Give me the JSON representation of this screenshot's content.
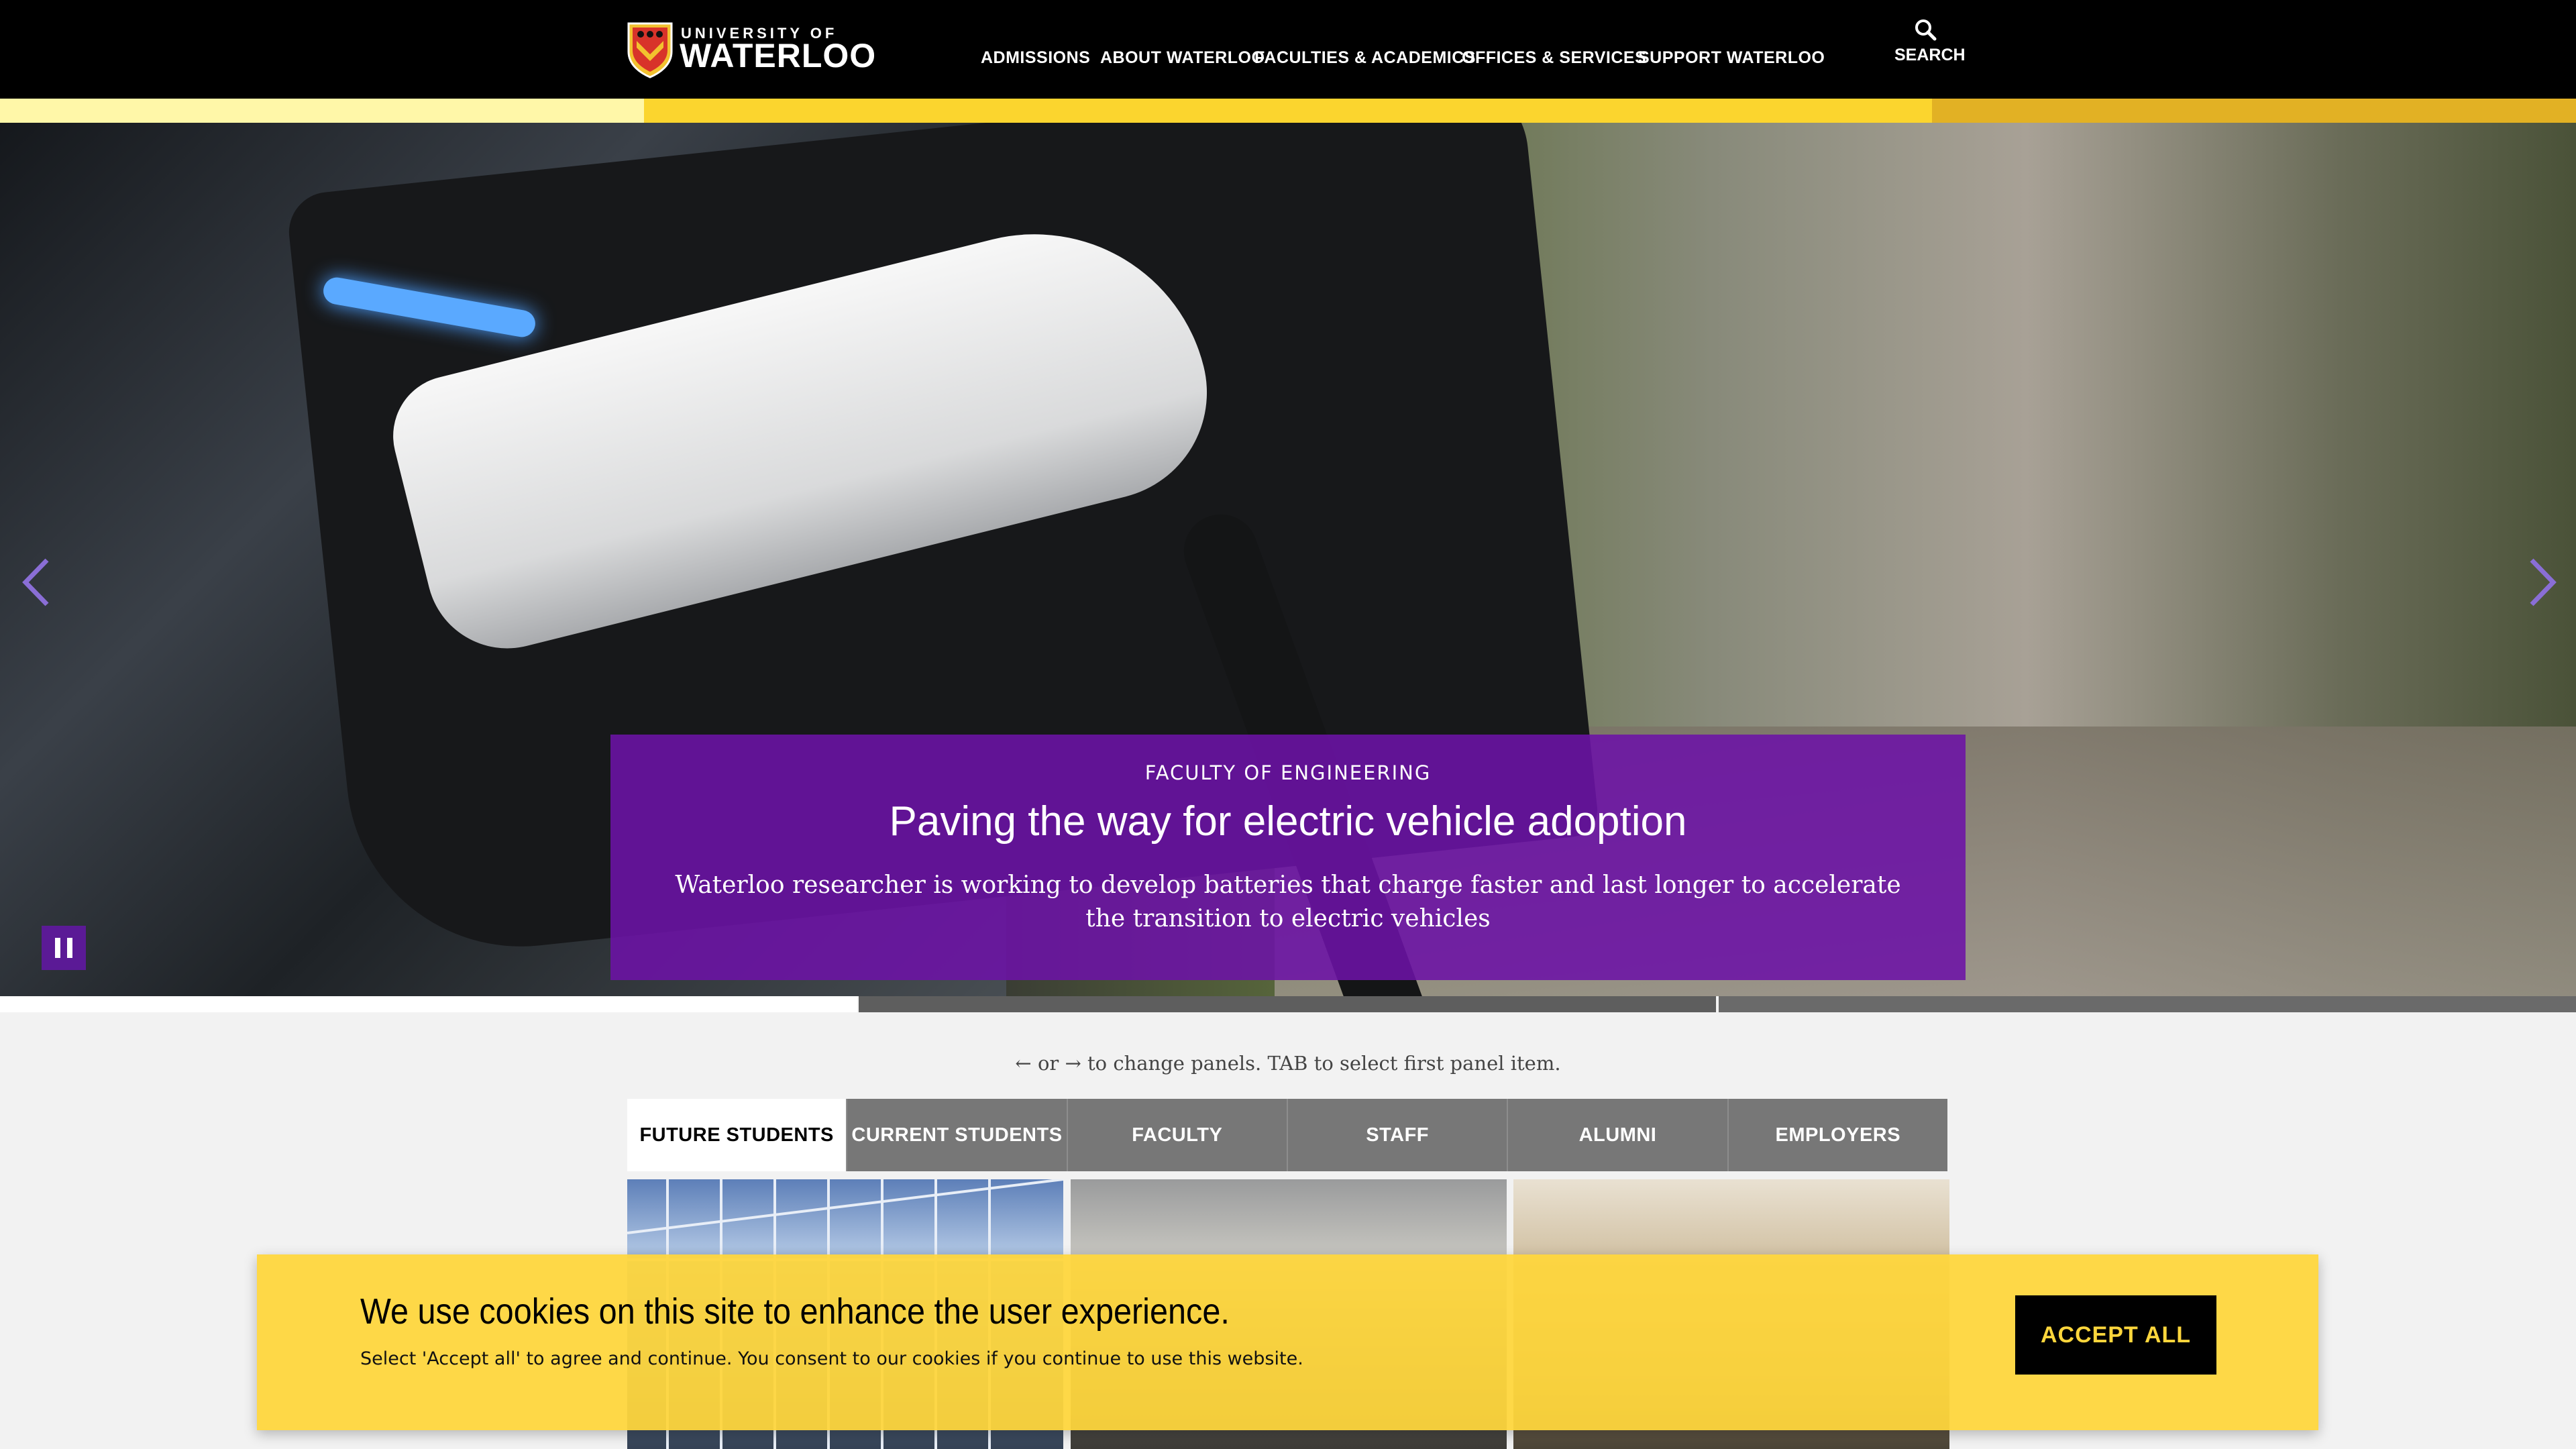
{
  "header": {
    "logo_line1": "UNIVERSITY OF",
    "logo_line2": "WATERLOO",
    "nav": [
      {
        "label": "ADMISSIONS"
      },
      {
        "label": "ABOUT WATERLOO"
      },
      {
        "label": "FACULTIES & ACADEMICS"
      },
      {
        "label": "OFFICES & SERVICES"
      },
      {
        "label": "SUPPORT WATERLOO"
      }
    ],
    "search_label": "SEARCH"
  },
  "hero": {
    "kicker": "FACULTY OF ENGINEERING",
    "title": "Paving the way for electric vehicle adoption",
    "description": "Waterloo researcher is working to develop batteries that charge faster and last longer to accelerate the transition to electric vehicles",
    "prev_icon": "chevron-left-icon",
    "next_icon": "chevron-right-icon",
    "pause_icon": "pause-icon"
  },
  "panels": {
    "hint": "← or → to change panels. TAB to select first panel item.",
    "tabs": [
      {
        "label": "FUTURE STUDENTS",
        "active": true
      },
      {
        "label": "CURRENT STUDENTS",
        "active": false
      },
      {
        "label": "FACULTY",
        "active": false
      },
      {
        "label": "STAFF",
        "active": false
      },
      {
        "label": "ALUMNI",
        "active": false
      },
      {
        "label": "EMPLOYERS",
        "active": false
      }
    ]
  },
  "cookie_banner": {
    "heading": "We use cookies on this site to enhance the user experience.",
    "text": "Select 'Accept all' to agree and continue. You consent to our cookies if you continue to use this website.",
    "accept_label": "ACCEPT ALL"
  },
  "colors": {
    "brand_black": "#000000",
    "brand_gold": "#FED63C",
    "caption_purple": "#6C12A6",
    "tab_inactive": "#777777"
  }
}
